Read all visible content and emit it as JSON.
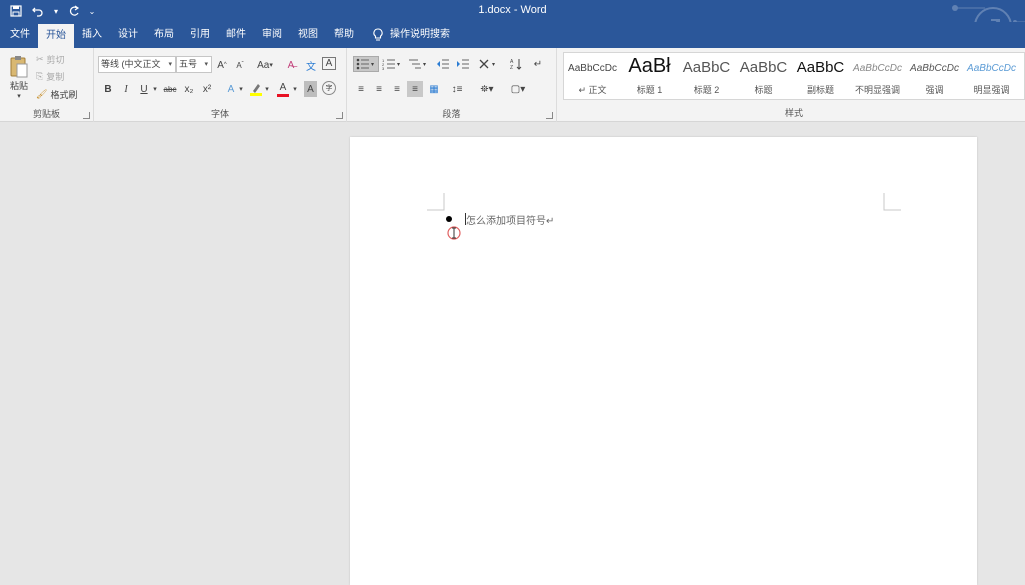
{
  "window": {
    "title": "1.docx  -  Word"
  },
  "qat": {
    "more": "⌄"
  },
  "tabs": [
    "文件",
    "开始",
    "插入",
    "设计",
    "布局",
    "引用",
    "邮件",
    "审阅",
    "视图",
    "帮助"
  ],
  "tell_me": "操作说明搜索",
  "clipboard": {
    "paste": "粘贴",
    "cut": "剪切",
    "copy": "复制",
    "format_painter": "格式刷",
    "group_label": "剪贴板"
  },
  "font": {
    "font_name": "等线 (中文正文",
    "font_size": "五号",
    "grow": "A",
    "shrink": "A",
    "change_case": "Aa",
    "bold": "B",
    "italic": "I",
    "underline": "U",
    "strikethrough": "abc",
    "subscript": "x₂",
    "superscript": "x²",
    "font_color_letter": "A",
    "char_shading_letter": "A",
    "enclose": "字",
    "group_label": "字体"
  },
  "paragraph": {
    "group_label": "段落"
  },
  "styles": {
    "group_label": "样式",
    "items": [
      {
        "sample": "AaBbCcDc",
        "name": "↵ 正文"
      },
      {
        "sample": "AaBł",
        "name": "标题 1"
      },
      {
        "sample": "AaBbC",
        "name": "标题 2"
      },
      {
        "sample": "AaBbC",
        "name": "标题"
      },
      {
        "sample": "AaBbC",
        "name": "副标题"
      },
      {
        "sample": "AaBbCcDc",
        "name": "不明显强调"
      },
      {
        "sample": "AaBbCcDc",
        "name": "强调"
      },
      {
        "sample": "AaBbCcDc",
        "name": "明显强调"
      }
    ]
  },
  "document": {
    "bullet_text": "怎么添加项目符号↵"
  },
  "colors": {
    "brand": "#2b579a",
    "highlight": "#ffff00",
    "font_color": "#e81123"
  }
}
